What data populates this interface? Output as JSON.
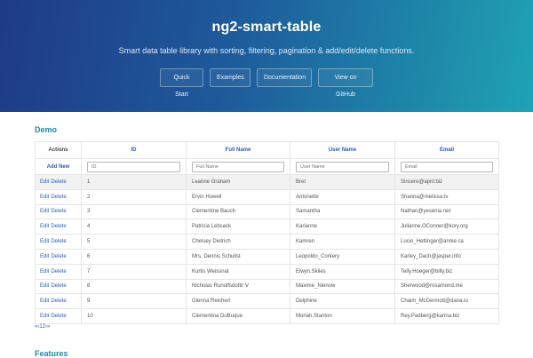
{
  "hero": {
    "title": "ng2-smart-table",
    "subtitle": "Smart data table library with sorting, filtering, pagination & add/edit/delete functions.",
    "buttons": [
      "Quick Start",
      "Examples",
      "Documentation",
      "View on GitHub"
    ]
  },
  "demo": {
    "section_title": "Demo",
    "columns": {
      "actions": "Actions",
      "id": "ID",
      "name": "Full Name",
      "username": "User Name",
      "email": "Email"
    },
    "add_new_label": "Add New",
    "filters": {
      "id_placeholder": "ID",
      "name_placeholder": "Full Name",
      "username_placeholder": "User Name",
      "email_placeholder": "Email"
    },
    "edit_label": "Edit",
    "delete_label": "Delete",
    "rows": [
      {
        "id": "1",
        "name": "Leanne Graham",
        "username": "Bret",
        "email": "Sincere@april.biz"
      },
      {
        "id": "2",
        "name": "Ervin Howell",
        "username": "Antonette",
        "email": "Shanna@melissa.tv"
      },
      {
        "id": "3",
        "name": "Clementine Bauch",
        "username": "Samantha",
        "email": "Nathan@yesenia.net"
      },
      {
        "id": "4",
        "name": "Patricia Lebsack",
        "username": "Karianne",
        "email": "Julianne.OConner@kory.org"
      },
      {
        "id": "5",
        "name": "Chelsey Dietrich",
        "username": "Kamren",
        "email": "Lucio_Hettinger@annie.ca"
      },
      {
        "id": "6",
        "name": "Mrs. Dennis Schulist",
        "username": "Leopoldo_Corkery",
        "email": "Karley_Dach@jasper.info"
      },
      {
        "id": "7",
        "name": "Kurtis Weissnat",
        "username": "Elwyn.Skiles",
        "email": "Telly.Hoeger@billy.biz"
      },
      {
        "id": "8",
        "name": "Nicholas Runolfsdottir V",
        "username": "Maxime_Nienow",
        "email": "Sherwood@rosamond.me"
      },
      {
        "id": "9",
        "name": "Glenna Reichert",
        "username": "Delphine",
        "email": "Chaim_McDermott@dana.io"
      },
      {
        "id": "10",
        "name": "Clementina DuBuque",
        "username": "Moriah.Stanton",
        "email": "Rey.Padberg@karina.biz"
      }
    ],
    "pager": "«‹12›»"
  },
  "features": {
    "section_title": "Features"
  }
}
